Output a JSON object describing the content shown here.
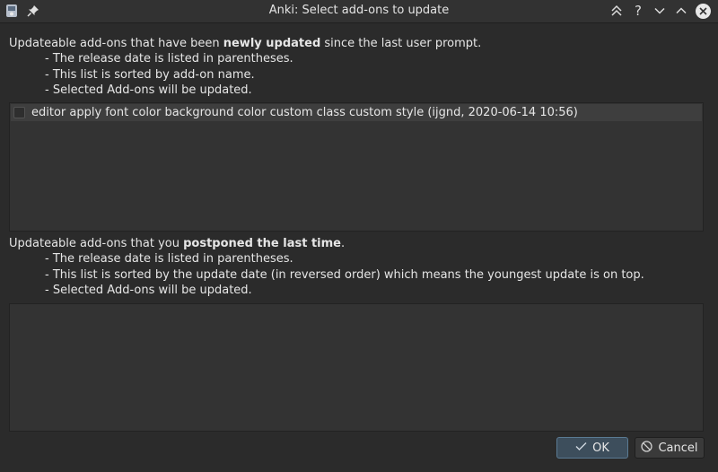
{
  "window": {
    "title": "Anki: Select add-ons to update"
  },
  "section1": {
    "intro_before": "Updateable add-ons that have been ",
    "intro_bold": "newly updated",
    "intro_after": " since the last user prompt.",
    "bullets": [
      "- The release date is listed in parentheses.",
      "- This list is sorted by add-on name.",
      "- Selected Add-ons will be updated."
    ],
    "items": [
      {
        "label": "editor apply font color background color custom class custom style  (ijgnd, 2020-06-14 10:56)",
        "checked": false
      }
    ]
  },
  "section2": {
    "intro_before": "Updateable add-ons that you ",
    "intro_bold": "postponed the last time",
    "intro_after": ".",
    "bullets": [
      "- The release date is listed in parentheses.",
      "- This list is sorted by the update date (in reversed order) which means the youngest update is on top.",
      "- Selected Add-ons will be updated."
    ],
    "items": []
  },
  "buttons": {
    "ok": "OK",
    "cancel": "Cancel"
  },
  "icons": {
    "app": "anki-app-icon",
    "pin": "pin-icon",
    "keep_above": "double-chevron-up-icon",
    "help": "question-icon",
    "minimize": "chevron-down-icon",
    "maximize": "chevron-up-icon",
    "close": "close-icon",
    "ok": "checkmark-icon",
    "cancel": "cancel-icon"
  },
  "colors": {
    "background": "#2b2b2b",
    "list_background": "#333333",
    "selected_row": "#3e3e3e",
    "ok_border": "#5a7a93"
  }
}
